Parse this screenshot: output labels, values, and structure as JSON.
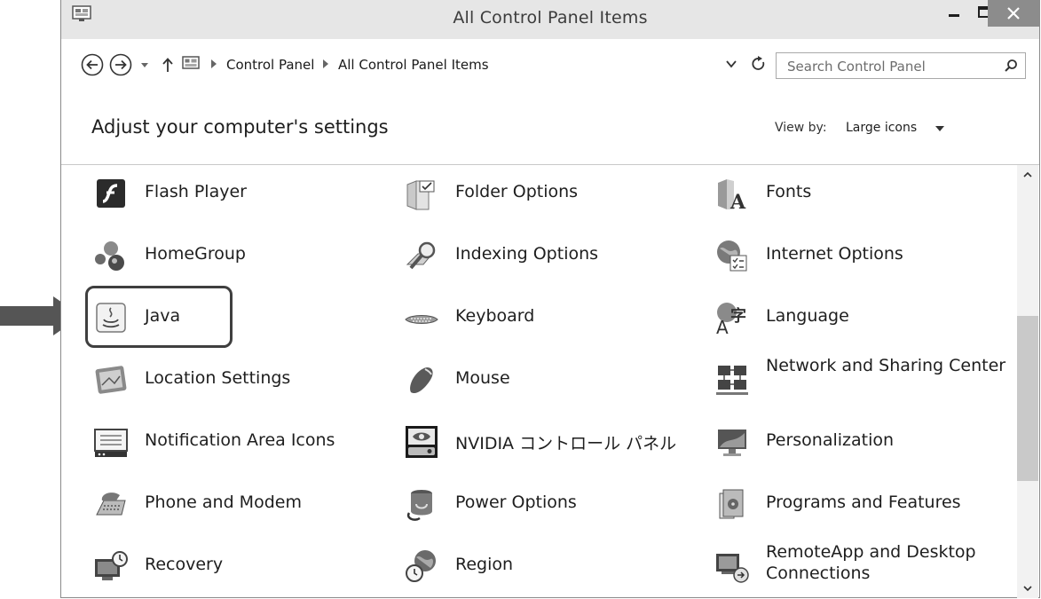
{
  "window": {
    "title": "All Control Panel Items",
    "controls": {
      "minimize": "minimize-icon",
      "maximize": "maximize-icon",
      "close": "close-icon"
    }
  },
  "address_bar": {
    "breadcrumbs": [
      "Control Panel",
      "All Control Panel Items"
    ],
    "search_placeholder": "Search Control Panel"
  },
  "header": {
    "title": "Adjust your computer's settings",
    "view_by_label": "View by:",
    "view_by_value": "Large icons"
  },
  "items": [
    {
      "label": "Flash Player",
      "icon": "flash-player-icon"
    },
    {
      "label": "Folder Options",
      "icon": "folder-options-icon"
    },
    {
      "label": "Fonts",
      "icon": "fonts-icon"
    },
    {
      "label": "HomeGroup",
      "icon": "homegroup-icon"
    },
    {
      "label": "Indexing Options",
      "icon": "indexing-options-icon"
    },
    {
      "label": "Internet Options",
      "icon": "internet-options-icon"
    },
    {
      "label": "Java",
      "icon": "java-icon",
      "highlighted": true
    },
    {
      "label": "Keyboard",
      "icon": "keyboard-icon"
    },
    {
      "label": "Language",
      "icon": "language-icon"
    },
    {
      "label": "Location Settings",
      "icon": "location-settings-icon"
    },
    {
      "label": "Mouse",
      "icon": "mouse-icon"
    },
    {
      "label": "Network and Sharing Center",
      "icon": "network-sharing-icon"
    },
    {
      "label": "Notification Area Icons",
      "icon": "notification-area-icon"
    },
    {
      "label": "NVIDIA コントロール パネル",
      "icon": "nvidia-icon"
    },
    {
      "label": "Personalization",
      "icon": "personalization-icon"
    },
    {
      "label": "Phone and Modem",
      "icon": "phone-modem-icon"
    },
    {
      "label": "Power Options",
      "icon": "power-options-icon"
    },
    {
      "label": "Programs and Features",
      "icon": "programs-features-icon"
    },
    {
      "label": "Recovery",
      "icon": "recovery-icon"
    },
    {
      "label": "Region",
      "icon": "region-icon"
    },
    {
      "label": "RemoteApp and Desktop Connections",
      "icon": "remoteapp-icon"
    }
  ],
  "colors": {
    "titlebar": "#e6e6e6",
    "close_button": "#8c8c8c",
    "highlight_border": "#3f3f3f",
    "callout_arrow": "#555555"
  }
}
